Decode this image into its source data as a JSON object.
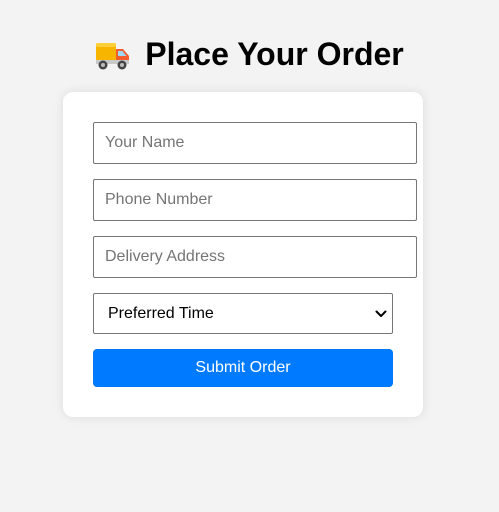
{
  "header": {
    "icon": "delivery-truck-icon",
    "title": "Place Your Order"
  },
  "form": {
    "name_placeholder": "Your Name",
    "phone_placeholder": "Phone Number",
    "address_placeholder": "Delivery Address",
    "time_selected": "Preferred Time",
    "submit_label": "Submit Order"
  },
  "colors": {
    "page_bg": "#f3f3f3",
    "accent": "#007bff"
  }
}
